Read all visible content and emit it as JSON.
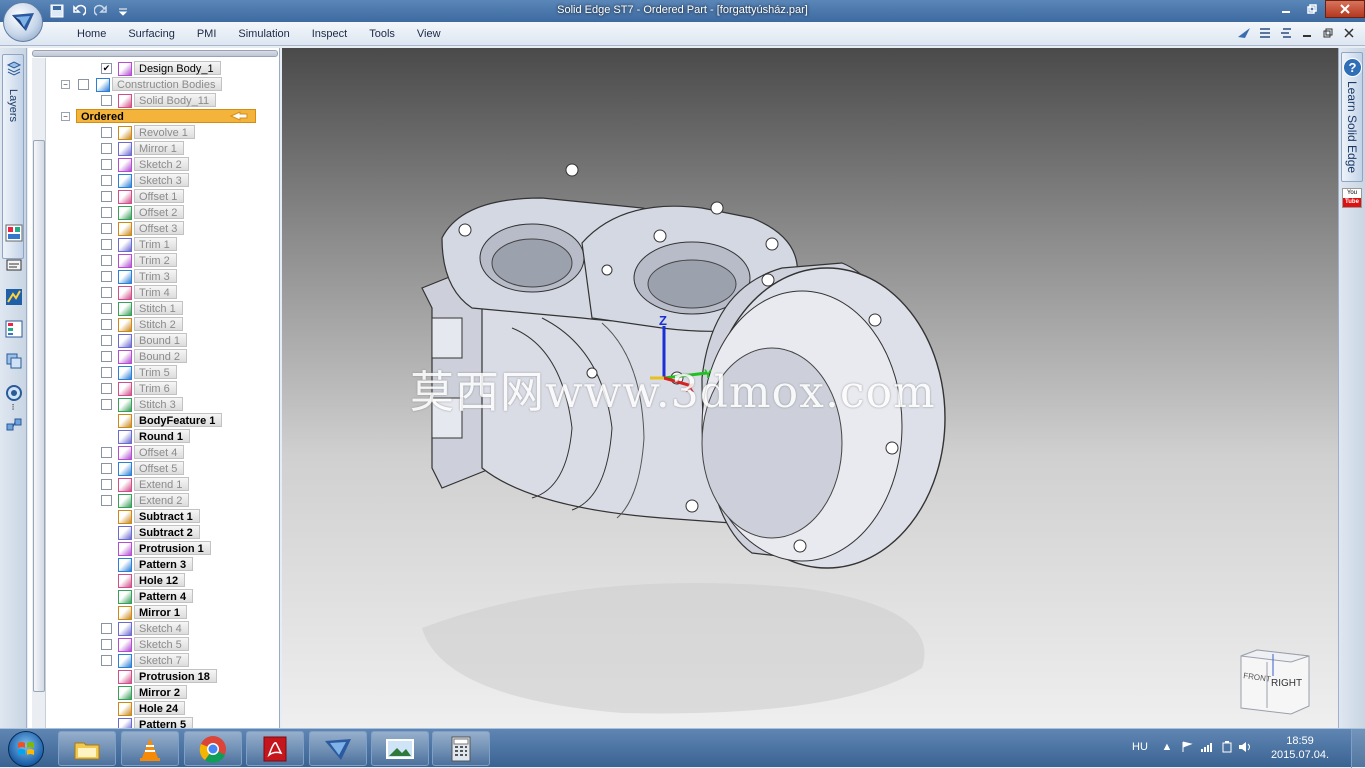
{
  "window": {
    "title": "Solid Edge ST7 - Ordered Part - [forgattyúsház.par]",
    "controls": [
      "minimize",
      "restore",
      "close"
    ]
  },
  "ribbon": {
    "tabs": [
      "Home",
      "Surfacing",
      "PMI",
      "Simulation",
      "Inspect",
      "Tools",
      "View"
    ]
  },
  "left_strip": {
    "layers_label": "Layers",
    "icons": [
      "layers-icon",
      "family-of-parts-icon",
      "feature-library-icon",
      "sensors-icon",
      "property-manager-icon",
      "pathfinder-icon",
      "teamcenter-icon"
    ]
  },
  "pathfinder": {
    "items": [
      {
        "label": "Design Body_1",
        "indent": 0,
        "expander": "",
        "checkbox": "checked",
        "style": "normal"
      },
      {
        "label": "Construction Bodies",
        "indent": 0,
        "expander": "minus",
        "checkbox": "unchecked",
        "style": "dim"
      },
      {
        "label": "Solid Body_11",
        "indent": 1,
        "expander": "",
        "checkbox": "unchecked",
        "style": "dim"
      },
      {
        "label": "Ordered",
        "indent": -1,
        "expander": "minus",
        "checkbox": "",
        "style": "selected"
      },
      {
        "label": "Revolve 1",
        "indent": 1,
        "expander": "",
        "checkbox": "unchecked",
        "style": "dim"
      },
      {
        "label": "Mirror 1",
        "indent": 1,
        "expander": "",
        "checkbox": "unchecked",
        "style": "dim"
      },
      {
        "label": "Sketch 2",
        "indent": 1,
        "expander": "",
        "checkbox": "unchecked",
        "style": "dim"
      },
      {
        "label": "Sketch 3",
        "indent": 1,
        "expander": "",
        "checkbox": "unchecked",
        "style": "dim"
      },
      {
        "label": "Offset 1",
        "indent": 1,
        "expander": "",
        "checkbox": "unchecked",
        "style": "dim"
      },
      {
        "label": "Offset 2",
        "indent": 1,
        "expander": "",
        "checkbox": "unchecked",
        "style": "dim"
      },
      {
        "label": "Offset 3",
        "indent": 1,
        "expander": "",
        "checkbox": "unchecked",
        "style": "dim"
      },
      {
        "label": "Trim 1",
        "indent": 1,
        "expander": "",
        "checkbox": "unchecked",
        "style": "dim"
      },
      {
        "label": "Trim 2",
        "indent": 1,
        "expander": "",
        "checkbox": "unchecked",
        "style": "dim"
      },
      {
        "label": "Trim 3",
        "indent": 1,
        "expander": "",
        "checkbox": "unchecked",
        "style": "dim"
      },
      {
        "label": "Trim 4",
        "indent": 1,
        "expander": "",
        "checkbox": "unchecked",
        "style": "dim"
      },
      {
        "label": "Stitch 1",
        "indent": 1,
        "expander": "",
        "checkbox": "unchecked",
        "style": "dim"
      },
      {
        "label": "Stitch 2",
        "indent": 1,
        "expander": "",
        "checkbox": "unchecked",
        "style": "dim"
      },
      {
        "label": "Bound 1",
        "indent": 1,
        "expander": "",
        "checkbox": "unchecked",
        "style": "dim"
      },
      {
        "label": "Bound 2",
        "indent": 1,
        "expander": "",
        "checkbox": "unchecked",
        "style": "dim"
      },
      {
        "label": "Trim 5",
        "indent": 1,
        "expander": "",
        "checkbox": "unchecked",
        "style": "dim"
      },
      {
        "label": "Trim 6",
        "indent": 1,
        "expander": "",
        "checkbox": "unchecked",
        "style": "dim"
      },
      {
        "label": "Stitch 3",
        "indent": 1,
        "expander": "",
        "checkbox": "unchecked",
        "style": "dim"
      },
      {
        "label": "BodyFeature 1",
        "indent": 1,
        "expander": "",
        "checkbox": "",
        "style": "bold"
      },
      {
        "label": "Round 1",
        "indent": 1,
        "expander": "",
        "checkbox": "",
        "style": "bold"
      },
      {
        "label": "Offset 4",
        "indent": 1,
        "expander": "",
        "checkbox": "unchecked",
        "style": "dim"
      },
      {
        "label": "Offset 5",
        "indent": 1,
        "expander": "",
        "checkbox": "unchecked",
        "style": "dim"
      },
      {
        "label": "Extend 1",
        "indent": 1,
        "expander": "",
        "checkbox": "unchecked",
        "style": "dim"
      },
      {
        "label": "Extend 2",
        "indent": 1,
        "expander": "",
        "checkbox": "unchecked",
        "style": "dim"
      },
      {
        "label": "Subtract 1",
        "indent": 1,
        "expander": "",
        "checkbox": "",
        "style": "bold"
      },
      {
        "label": "Subtract 2",
        "indent": 1,
        "expander": "",
        "checkbox": "",
        "style": "bold"
      },
      {
        "label": "Protrusion 1",
        "indent": 1,
        "expander": "",
        "checkbox": "",
        "style": "bold"
      },
      {
        "label": "Pattern 3",
        "indent": 1,
        "expander": "",
        "checkbox": "",
        "style": "bold"
      },
      {
        "label": "Hole 12",
        "indent": 1,
        "expander": "",
        "checkbox": "",
        "style": "bold"
      },
      {
        "label": "Pattern 4",
        "indent": 1,
        "expander": "",
        "checkbox": "",
        "style": "bold"
      },
      {
        "label": "Mirror 1",
        "indent": 1,
        "expander": "",
        "checkbox": "",
        "style": "bold"
      },
      {
        "label": "Sketch 4",
        "indent": 1,
        "expander": "",
        "checkbox": "unchecked",
        "style": "dim"
      },
      {
        "label": "Sketch 5",
        "indent": 1,
        "expander": "",
        "checkbox": "unchecked",
        "style": "dim"
      },
      {
        "label": "Sketch 7",
        "indent": 1,
        "expander": "",
        "checkbox": "unchecked",
        "style": "dim"
      },
      {
        "label": "Protrusion 18",
        "indent": 1,
        "expander": "",
        "checkbox": "",
        "style": "bold"
      },
      {
        "label": "Mirror 2",
        "indent": 1,
        "expander": "",
        "checkbox": "",
        "style": "bold"
      },
      {
        "label": "Hole 24",
        "indent": 1,
        "expander": "",
        "checkbox": "",
        "style": "bold"
      },
      {
        "label": "Pattern 5",
        "indent": 1,
        "expander": "",
        "checkbox": "",
        "style": "bold"
      }
    ]
  },
  "viewport": {
    "triad_labels": {
      "z": "Z",
      "x": "X",
      "y": "Y"
    },
    "watermark": "莫西网www.3dmox.com",
    "view_cube": {
      "front": "FRONT",
      "right": "RIGHT"
    }
  },
  "right_strip": {
    "learn_label": "Learn Solid Edge",
    "help_glyph": "?",
    "youtube_top": "You",
    "youtube_bottom": "Tube"
  },
  "taskbar": {
    "apps": [
      "windows-explorer",
      "vlc",
      "chrome",
      "adobe-reader",
      "solid-edge",
      "image-viewer",
      "calculator"
    ],
    "language": "HU",
    "time": "18:59",
    "date": "2015.07.04."
  },
  "colors": {
    "selected_row": "#f4b43c",
    "viewport_top": "#4a4a4a",
    "viewport_bottom": "#efefef",
    "title_bar": "#3d6aa0"
  }
}
